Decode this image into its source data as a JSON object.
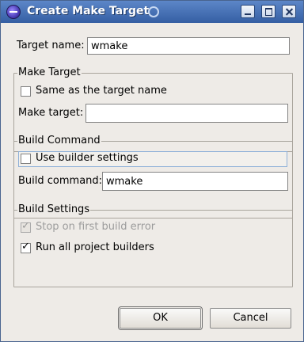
{
  "window": {
    "title": "Create Make Target"
  },
  "target_name": {
    "label": "Target name:",
    "value": "wmake"
  },
  "make_target": {
    "legend": "Make Target",
    "same_as_label": "Same as the target name",
    "same_as_checked": false,
    "field_label": "Make target:",
    "field_value": ""
  },
  "build_command": {
    "legend": "Build Command",
    "use_builder_label": "Use builder settings",
    "use_builder_checked": false,
    "field_label": "Build command:",
    "field_value": "wmake"
  },
  "build_settings": {
    "legend": "Build Settings",
    "stop_label": "Stop on first build error",
    "stop_checked": true,
    "run_all_label": "Run all project builders",
    "run_all_checked": true
  },
  "buttons": {
    "ok": "OK",
    "cancel": "Cancel"
  }
}
